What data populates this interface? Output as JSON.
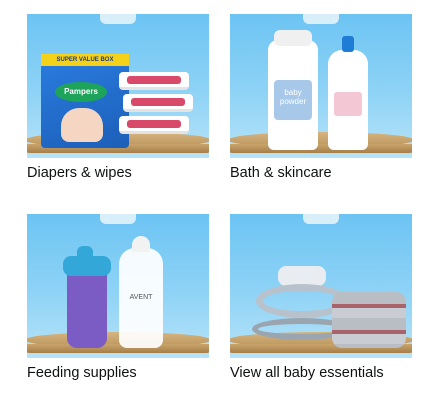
{
  "tiles": [
    {
      "label": "Diapers & wipes",
      "image": "diapers-wipes-image",
      "box_band": "SUPER VALUE BOX",
      "box_brand": "Pampers"
    },
    {
      "label": "Bath & skincare",
      "image": "bath-skincare-image",
      "bottle_label": "baby powder"
    },
    {
      "label": "Feeding supplies",
      "image": "feeding-supplies-image",
      "bottle_brand": "AVENT"
    },
    {
      "label": "View all baby essentials",
      "image": "baby-essentials-image"
    }
  ],
  "colors": {
    "sky": "#7ccbf4",
    "shelf": "#c9a46b",
    "text": "#0f1111"
  }
}
